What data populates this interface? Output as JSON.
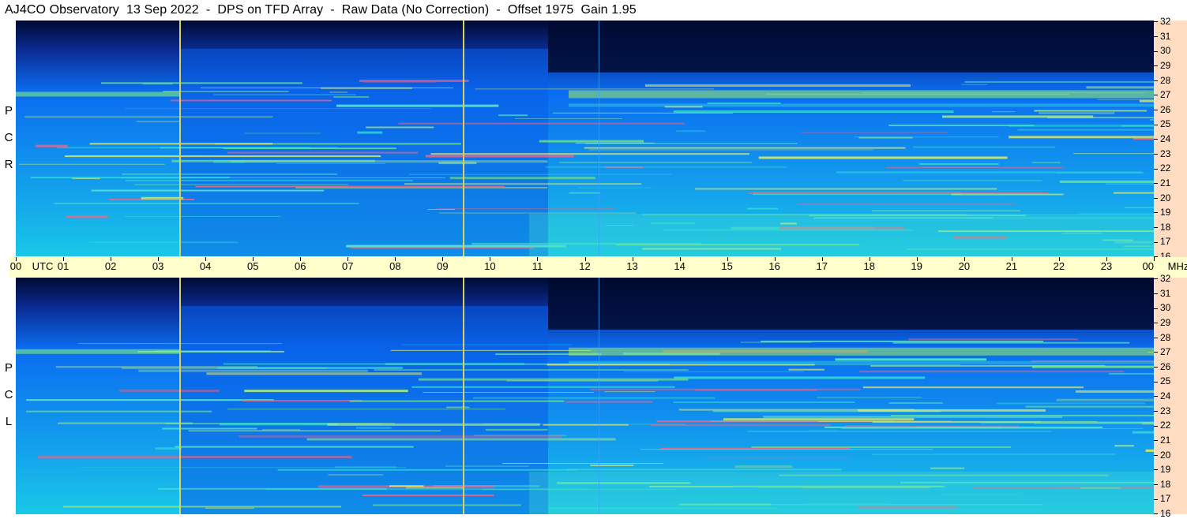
{
  "title": "AJ4CO Observatory  13 Sep 2022  -  DPS on TFD Array  -  Raw Data (No Correction)  -  Offset 1975  Gain 1.95",
  "panels": [
    {
      "id": "top",
      "polarization_letters": [
        "R",
        "C",
        "P"
      ]
    },
    {
      "id": "bottom",
      "polarization_letters": [
        "L",
        "C",
        "P"
      ]
    }
  ],
  "freq_ticks": [
    "32",
    "31",
    "30",
    "29",
    "28",
    "27",
    "26",
    "25",
    "24",
    "23",
    "22",
    "21",
    "20",
    "19",
    "18",
    "17",
    "16"
  ],
  "time_axis": {
    "labels": [
      "00",
      "01",
      "02",
      "03",
      "04",
      "05",
      "06",
      "07",
      "08",
      "09",
      "10",
      "11",
      "12",
      "13",
      "14",
      "15",
      "16",
      "17",
      "18",
      "19",
      "20",
      "21",
      "22",
      "23",
      "00"
    ],
    "utc_label": "UTC",
    "mhz_label": "MHz"
  },
  "colors": {
    "background_dark": "#000a30",
    "spectrum_mid": "#0a6cf0",
    "spectrum_bright": "#18c8e8",
    "noise_band": "#7ef07a",
    "marker_line": "#d8d060",
    "time_axis_bg": "#ffffcc",
    "freq_axis_bg": "#ffdcc2"
  }
}
